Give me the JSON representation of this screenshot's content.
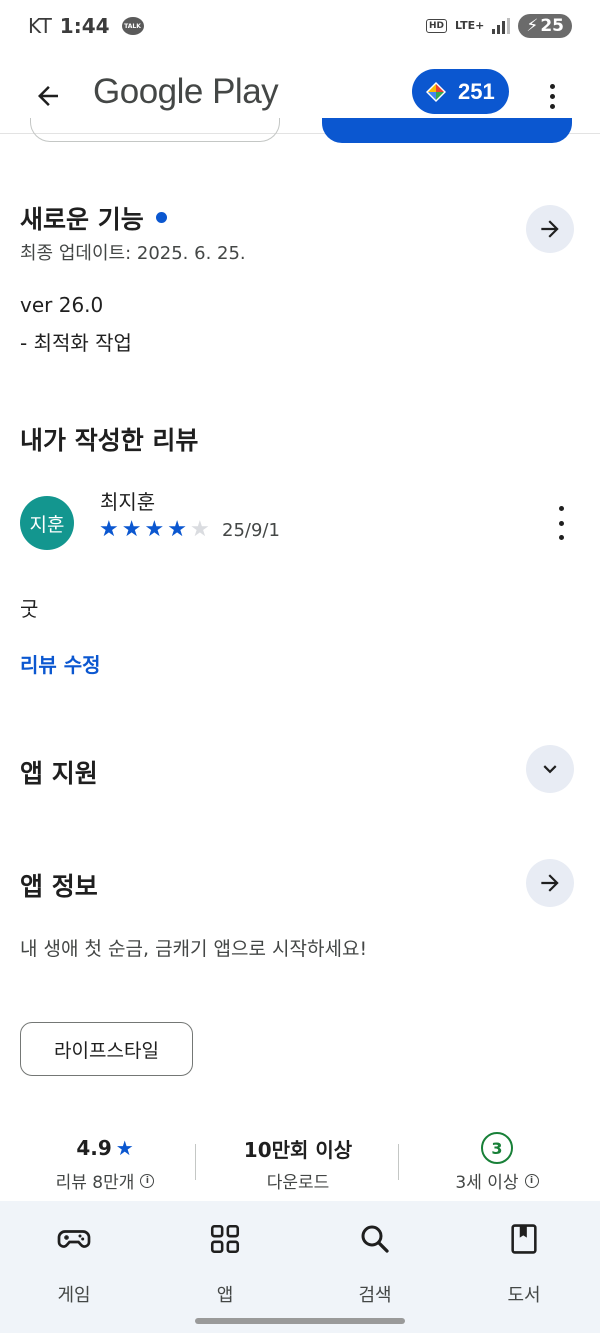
{
  "status_bar": {
    "carrier": "KT",
    "time": "1:44",
    "talk_label": "TALK",
    "hd_label": "HD",
    "network": "LTE+",
    "battery": "25"
  },
  "app_bar": {
    "title": "Google Play",
    "points": "251"
  },
  "whats_new": {
    "title": "새로운 기능",
    "updated": "최종 업데이트: 2025. 6. 25.",
    "version": "ver 26.0",
    "notes": "- 최적화 작업"
  },
  "my_review": {
    "section_title": "내가 작성한 리뷰",
    "avatar_text": "지훈",
    "author": "최지훈",
    "rating": 4,
    "rating_max": 5,
    "date": "25/9/1",
    "text": "굿",
    "edit_label": "리뷰 수정"
  },
  "app_support": {
    "title": "앱 지원"
  },
  "app_info": {
    "title": "앱 정보",
    "description": "내 생애 첫 순금, 금캐기 앱으로 시작하세요!",
    "category_chip": "라이프스타일"
  },
  "stats": {
    "rating_value": "4.9",
    "rating_label": "리뷰 8만개",
    "downloads_value": "10만회 이상",
    "downloads_label": "다운로드",
    "age_value": "3",
    "age_label": "3세 이상"
  },
  "bottom_nav": {
    "items": [
      {
        "label": "게임",
        "icon": "gamepad-icon"
      },
      {
        "label": "앱",
        "icon": "apps-grid-icon"
      },
      {
        "label": "검색",
        "icon": "search-icon"
      },
      {
        "label": "도서",
        "icon": "book-icon"
      }
    ]
  },
  "colors": {
    "accent": "#0b57d0",
    "avatar_bg": "#13968f",
    "age_badge": "#188038",
    "nav_bg": "#f0f4f9"
  }
}
